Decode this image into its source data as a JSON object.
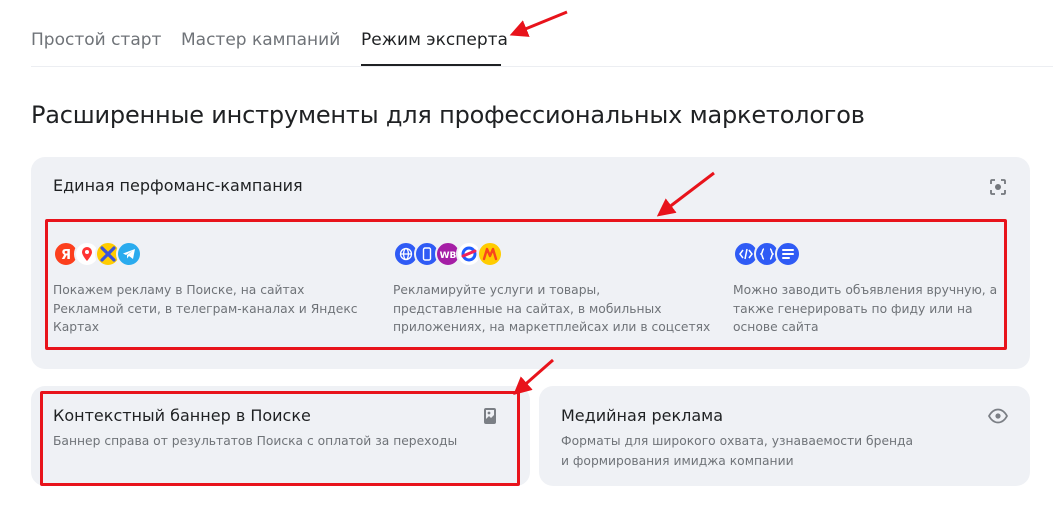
{
  "tabs": [
    {
      "label": "Простой старт"
    },
    {
      "label": "Мастер кампаний"
    },
    {
      "label": "Режим эксперта",
      "active": true
    }
  ],
  "page_title": "Расширенные инструменты для профессиональных маркетологов",
  "performance_card": {
    "title": "Единая перфоманс-кампания",
    "corner_icon": "focus-scan-icon",
    "features": [
      {
        "icons": [
          "yandex-icon",
          "maps-pin-icon",
          "apps-icon",
          "telegram-icon"
        ],
        "text": "Покажем рекламу в Поиске, на сайтах Рекламной сети, в телеграм-каналах и Яндекс Картах"
      },
      {
        "icons": [
          "globe-icon",
          "mobile-app-icon",
          "wildberries-icon",
          "ozon-icon",
          "yandex-market-icon"
        ],
        "wb_label": "WB",
        "text": "Рекламируйте услуги и товары, представленные на сайтах, в мобильных приложениях, на маркетплейсах или в соцсетях"
      },
      {
        "icons": [
          "code-icon",
          "feed-braces-icon",
          "site-list-icon"
        ],
        "text": "Можно заводить объявления вручную, а также генерировать по фиду или на основе сайта"
      }
    ]
  },
  "context_banner_card": {
    "title": "Контекстный баннер в Поиске",
    "desc": "Баннер справа от результатов Поиска с оплатой за переходы",
    "corner_icon": "image-icon"
  },
  "media_card": {
    "title": "Медийная реклама",
    "desc_line1": "Форматы для широкого охвата, узнаваемости бренда",
    "desc_line2": "и формирования имиджа компании",
    "corner_icon": "eye-icon"
  },
  "colors": {
    "card_bg": "#eff1f5",
    "annotation_red": "#e8131b",
    "text_primary": "#1f2123",
    "text_secondary": "#6f7378"
  }
}
